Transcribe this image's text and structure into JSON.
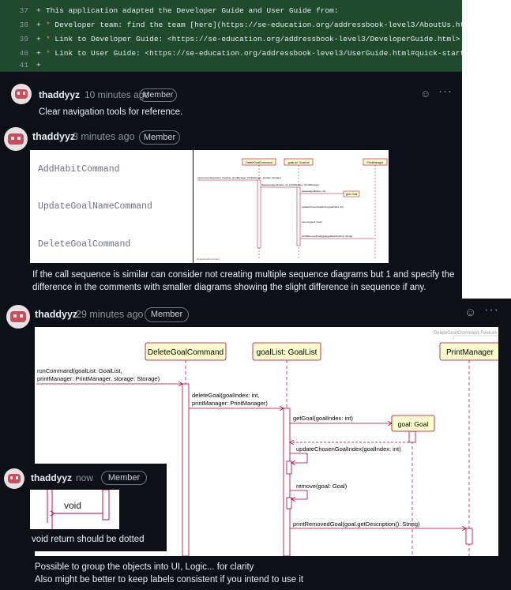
{
  "diff": {
    "lines": [
      {
        "num": "37",
        "text": "This application adapted the Developer Guide and User Guide from:",
        "bullet": false
      },
      {
        "num": "38",
        "text": "Developer team: find the team [here](https://se-education.org/addressbook-level3/AboutUs.html)",
        "bullet": true
      },
      {
        "num": "39",
        "text": "Link to Developer Guide: <https://se-education.org/addressbook-level3/DeveloperGuide.html>",
        "bullet": true
      },
      {
        "num": "40",
        "text": "Link to User Guide: <https://se-education.org/addressbook-level3/UserGuide.html#quick-start>",
        "bullet": true
      },
      {
        "num": "41",
        "text": "",
        "bullet": false
      }
    ]
  },
  "comment1": {
    "user": "thaddyyz",
    "time": "10 minutes ago",
    "badge": "Member",
    "body": "Clear navigation tools for reference."
  },
  "comment2": {
    "user": "thaddyyz",
    "time": "3 minutes ago",
    "badge": "Member",
    "commands": [
      "AddHabitCommand",
      "UpdateGoalNameCommand",
      "DeleteGoalCommand"
    ],
    "body": "If the call sequence is similar can consider not creating multiple sequence diagrams but 1 and specify the difference in the comments with smaller diagrams showing the slight difference in sequence if any."
  },
  "comment3": {
    "user": "thaddyyz",
    "time": "29 minutes ago",
    "badge": "Member",
    "body_line1": "Possible to group the objects into UI, Logic... for clarity",
    "body_line2": "Also might be better to keep labels consistent if you intend to use it"
  },
  "comment4": {
    "user": "thaddyyz",
    "time": "now",
    "badge": "Member",
    "void_label": "void",
    "body": "void return should be dotted"
  },
  "diagram": {
    "frame_title": "DeleteGoalCommand Feature",
    "participants": [
      "DeleteGoalCommand",
      "goalList: GoalList",
      "PrintManager"
    ],
    "created": "goal: Goal",
    "msg_run_1": "runCommand(goalList: GoalList,",
    "msg_run_2": "printManager: PrintManager, storage: Storage)",
    "msg_delete_1": "deleteGoal(goalIndex: int,",
    "msg_delete_2": "printManager: PrintManager)",
    "msg_getgoal": "getGoal(goalIndex: int)",
    "msg_update": "updateChosenGoalIndex(goalIndex: int)",
    "msg_remove": "remove(goal: Goal)",
    "msg_print": "printRemovedGoal(goal.getDescription(): String)"
  },
  "small_diagram": {
    "participants": [
      "DeleteGoalCommand",
      "goalList: GoalList",
      "PrintManager"
    ],
    "created": "goal: Goal",
    "msg_run": "runCommand(goalList: GoalList, printManager: PrintManager, storage: Storage)",
    "msg_delete": "deleteGoal(goalIndex: int, printManager: PrintManager)",
    "msg_getgoal": "getGoal(goalIndex: int)",
    "msg_update": "updateChosenGoalIndex(goalIndex: int)",
    "msg_remove": "remove(goal: Goal)",
    "msg_print": "printRemovedGoal(goal.getDescription(): String)",
    "footer": "DeleteGoalCommand"
  },
  "colors": {
    "diff_bg": "#1f4a2c",
    "panel_bg": "#0d1117",
    "lifeline_box": "#fefece",
    "box_border": "#a80036"
  }
}
